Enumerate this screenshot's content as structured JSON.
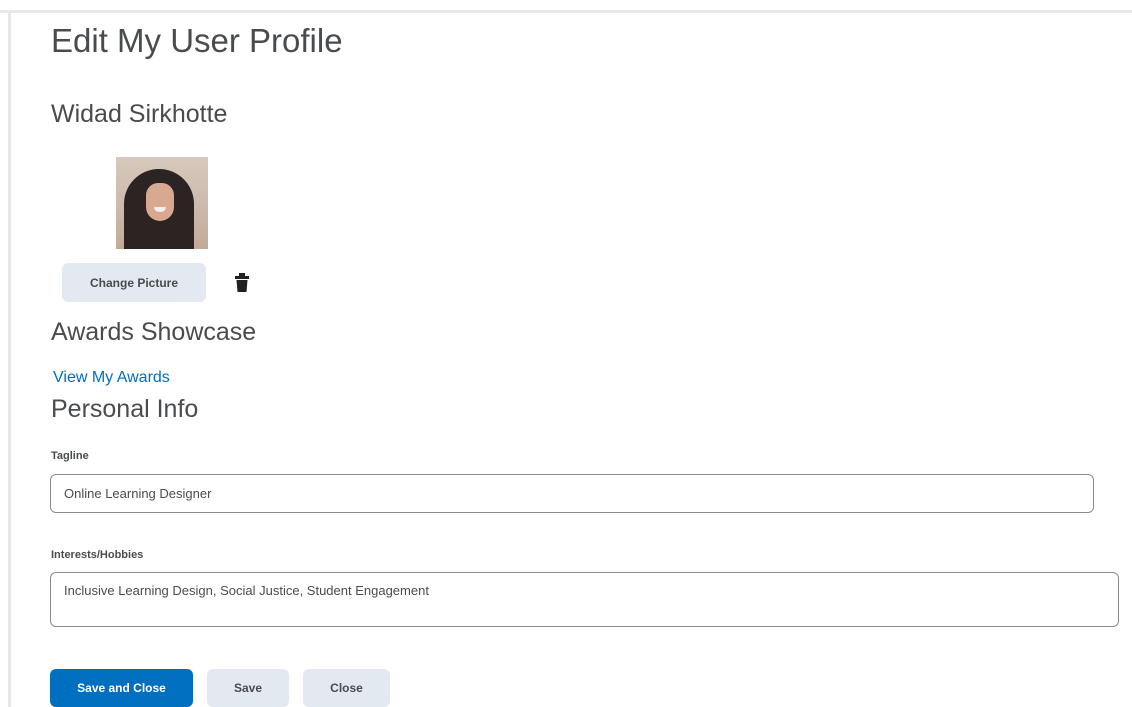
{
  "page": {
    "title": "Edit My User Profile",
    "user_name": "Widad Sirkhotte"
  },
  "profile_picture": {
    "change_label": "Change Picture",
    "delete_icon": "trash-icon"
  },
  "awards": {
    "heading": "Awards Showcase",
    "link_label": "View My Awards"
  },
  "personal_info": {
    "heading": "Personal Info",
    "tagline_label": "Tagline",
    "tagline_value": "Online Learning Designer",
    "interests_label": "Interests/Hobbies",
    "interests_value": "Inclusive Learning Design, Social Justice, Student Engagement"
  },
  "actions": {
    "save_and_close": "Save and Close",
    "save": "Save",
    "close": "Close"
  },
  "colors": {
    "primary": "#006fbf",
    "secondary_button": "#e3e9f1",
    "text": "#494c4e",
    "link": "#006fbf"
  }
}
